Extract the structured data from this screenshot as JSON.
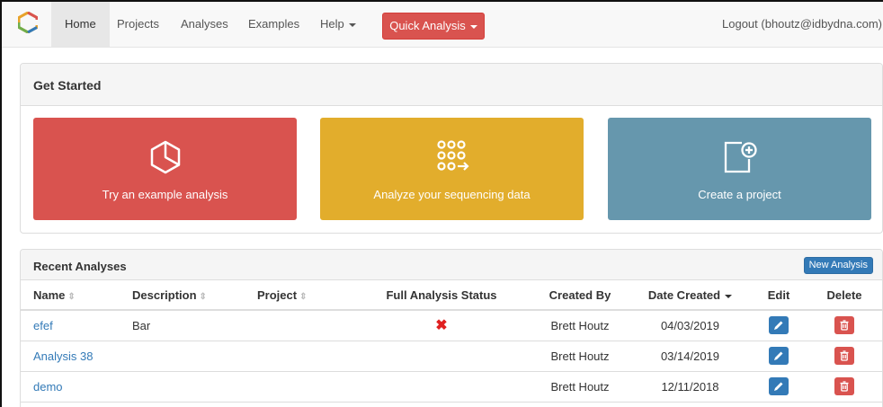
{
  "nav": {
    "items": [
      {
        "label": "Home"
      },
      {
        "label": "Projects"
      },
      {
        "label": "Analyses"
      },
      {
        "label": "Examples"
      },
      {
        "label": "Help"
      }
    ],
    "quick_analysis_label": "Quick Analysis",
    "logout_label": "Logout (bhoutz@idbydna.com)"
  },
  "get_started": {
    "title": "Get Started",
    "cards": [
      {
        "label": "Try an example analysis",
        "icon": "cube-icon",
        "color": "#d9534f"
      },
      {
        "label": "Analyze your sequencing data",
        "icon": "dots-grid-arrow-icon",
        "color": "#e2ad2c"
      },
      {
        "label": "Create a project",
        "icon": "add-document-icon",
        "color": "#6697ad"
      }
    ]
  },
  "recent": {
    "title": "Recent Analyses",
    "new_button_label": "New Analysis",
    "columns": [
      "Name",
      "Description",
      "Project",
      "Full Analysis Status",
      "Created By",
      "Date Created",
      "Edit",
      "Delete"
    ],
    "rows": [
      {
        "name": "efef",
        "description": "Bar",
        "project": "",
        "status": "✖",
        "created_by": "Brett Houtz",
        "date": "04/03/2019"
      },
      {
        "name": "Analysis 38",
        "description": "",
        "project": "",
        "status": "",
        "created_by": "Brett Houtz",
        "date": "03/14/2019"
      },
      {
        "name": "demo",
        "description": "",
        "project": "",
        "status": "",
        "created_by": "Brett Houtz",
        "date": "12/11/2018"
      }
    ]
  },
  "colors": {
    "primary": "#337ab7",
    "danger": "#d9534f",
    "warning": "#e2ad2c",
    "info": "#6697ad"
  }
}
